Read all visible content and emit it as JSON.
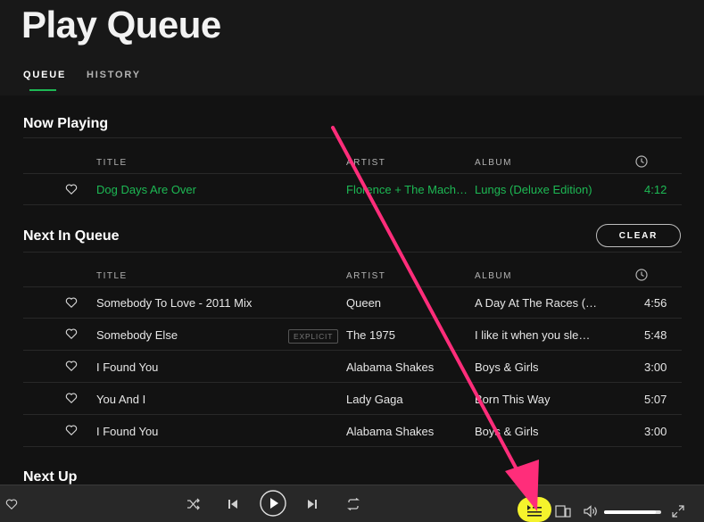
{
  "page": {
    "title": "Play Queue"
  },
  "tabs": [
    {
      "label": "QUEUE",
      "active": true
    },
    {
      "label": "HISTORY",
      "active": false
    }
  ],
  "now_playing": {
    "heading": "Now Playing",
    "columns": {
      "title": "TITLE",
      "artist": "ARTIST",
      "album": "ALBUM"
    },
    "track": {
      "title": "Dog Days Are Over",
      "artist": "Florence + The Mach…",
      "album": "Lungs (Deluxe Edition)",
      "duration": "4:12"
    }
  },
  "next_in_queue": {
    "heading": "Next In Queue",
    "clear_label": "CLEAR",
    "columns": {
      "title": "TITLE",
      "artist": "ARTIST",
      "album": "ALBUM"
    },
    "tracks": [
      {
        "title": "Somebody To Love - 2011 Mix",
        "artist": "Queen",
        "album": "A Day At The Races (…",
        "duration": "4:56"
      },
      {
        "title": "Somebody Else",
        "explicit": "EXPLICIT",
        "artist": "The 1975",
        "album": "I like it when you sle…",
        "duration": "5:48"
      },
      {
        "title": "I Found You",
        "artist": "Alabama Shakes",
        "album": "Boys & Girls",
        "duration": "3:00"
      },
      {
        "title": "You And I",
        "artist": "Lady Gaga",
        "album": "Born This Way",
        "duration": "5:07"
      },
      {
        "title": "I Found You",
        "artist": "Alabama Shakes",
        "album": "Boys & Girls",
        "duration": "3:00"
      }
    ]
  },
  "next_up": {
    "heading": "Next Up"
  },
  "player": {
    "volume_level": 0.9
  },
  "colors": {
    "accent": "#1db954",
    "annotation_arrow": "#ff2d7a",
    "highlight": "#f5f32c"
  }
}
